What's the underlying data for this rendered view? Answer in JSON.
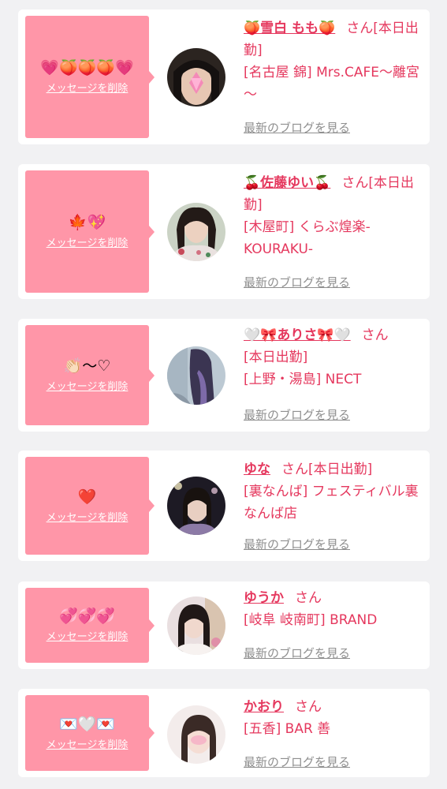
{
  "colors": {
    "background": "#f1f1f3",
    "card": "#ffffff",
    "bubble": "#ff96a8",
    "accent_text": "#e5385e",
    "link_gray": "#8f8f8f"
  },
  "entries": [
    {
      "emoji": "💗🍑🍑🍑💗",
      "delete_label": "メッセージを削除",
      "avatar_icon": "profile-photo",
      "name": "🍑雪白 もも🍑",
      "honorific": "さん",
      "status": "[本日出勤]",
      "shop": "[名古屋 錦] Mrs.CAFE～離宮～",
      "blog_label": "最新のブログを見る"
    },
    {
      "emoji": "🍁💖",
      "delete_label": "メッセージを削除",
      "avatar_icon": "profile-photo",
      "name": "🍒佐藤ゆい🍒",
      "honorific": "さん",
      "status": "[本日出勤]",
      "shop": "[木屋町] くらぶ煌楽-KOURAKU-",
      "blog_label": "最新のブログを見る"
    },
    {
      "emoji": "👏🏻〜♡",
      "delete_label": "メッセージを削除",
      "avatar_icon": "profile-photo",
      "name": "🤍🎀ありさ🎀🤍",
      "honorific": "さん",
      "status": "[本日出勤]",
      "shop": "[上野・湯島] NECT",
      "blog_label": "最新のブログを見る"
    },
    {
      "emoji": "❤️",
      "delete_label": "メッセージを削除",
      "avatar_icon": "profile-photo",
      "name": "ゆな",
      "honorific": "さん",
      "status": "[本日出勤]",
      "shop": "[裏なんば] フェスティバル裏なんば店",
      "blog_label": "最新のブログを見る"
    },
    {
      "emoji": "💞💞💞",
      "delete_label": "メッセージを削除",
      "avatar_icon": "profile-photo",
      "name": "ゆうか",
      "honorific": "さん",
      "status": "",
      "shop": "[岐阜 岐南町] BRAND",
      "blog_label": "最新のブログを見る"
    },
    {
      "emoji": "💌🤍💌",
      "delete_label": "メッセージを削除",
      "avatar_icon": "profile-photo",
      "name": "かおり",
      "honorific": "さん",
      "status": "",
      "shop": "[五香] BAR 善",
      "blog_label": "最新のブログを見る"
    }
  ]
}
